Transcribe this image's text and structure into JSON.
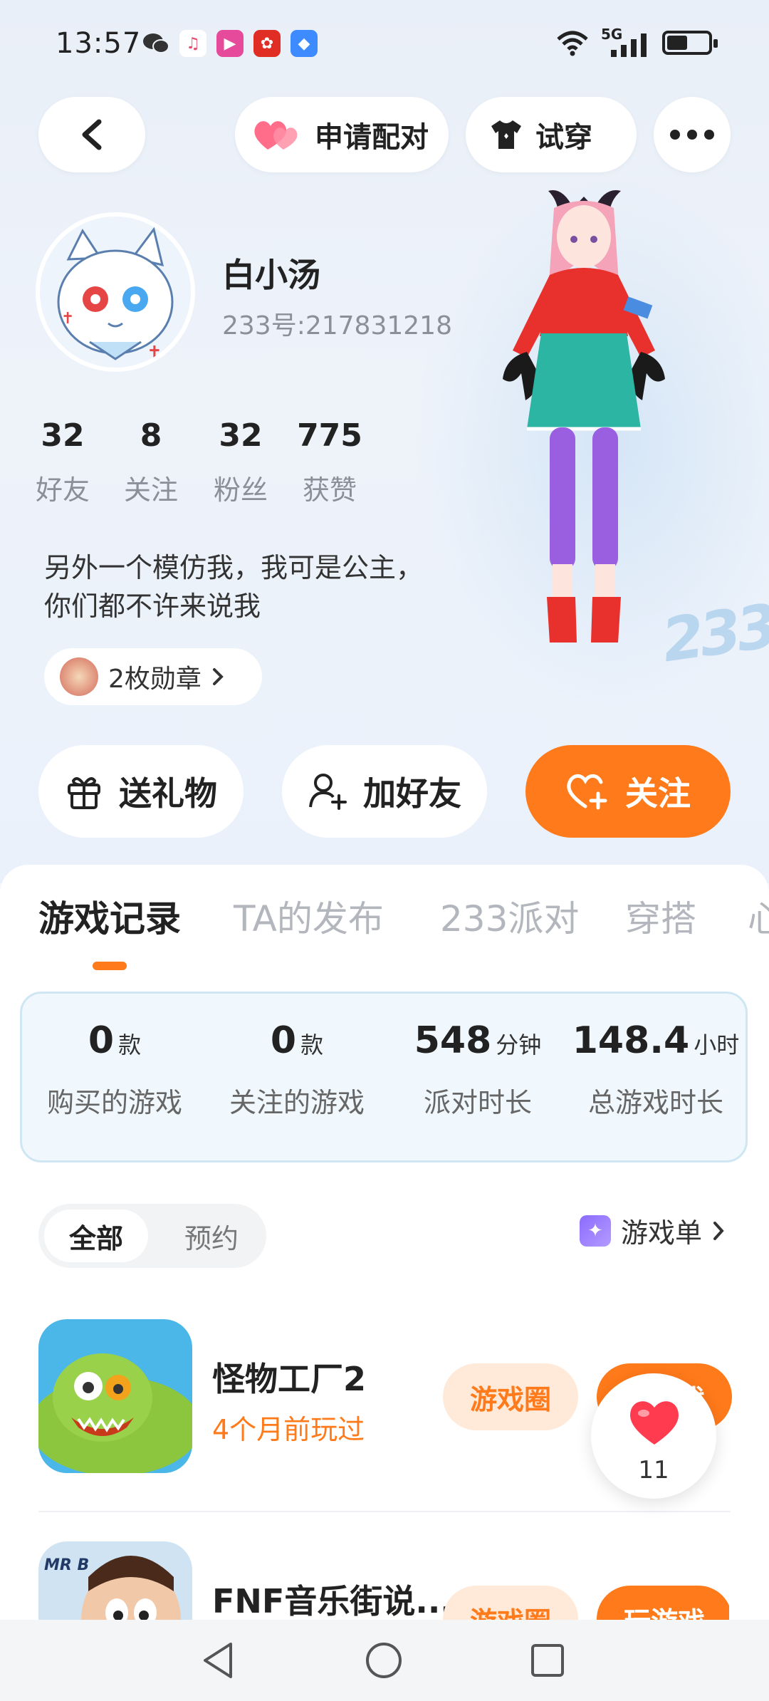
{
  "status_bar": {
    "time": "13:57",
    "network": "5G",
    "icons": [
      "wechat-icon",
      "music-icon",
      "video-icon",
      "pinduoduo-icon",
      "appstore-icon",
      "wifi-icon",
      "signal-icon",
      "battery-icon"
    ]
  },
  "header": {
    "back_icon": "chevron-left-icon",
    "pair_label": "申请配对",
    "tryon_label": "试穿",
    "more_icon": "more-icon"
  },
  "profile": {
    "name": "白小汤",
    "uid": "233号:217831218",
    "stats": [
      {
        "value": "32",
        "label": "好友"
      },
      {
        "value": "8",
        "label": "关注"
      },
      {
        "value": "32",
        "label": "粉丝"
      },
      {
        "value": "775",
        "label": "获赞"
      }
    ],
    "bio_line1": "另外一个模仿我，我可是公主，",
    "bio_line2": "你们都不许来说我",
    "medals_label": "2枚勋章"
  },
  "actions": {
    "gift_label": "送礼物",
    "add_friend_label": "加好友",
    "follow_label": "关注"
  },
  "tabs": [
    "游戏记录",
    "TA的发布",
    "233派对",
    "穿搭",
    "心"
  ],
  "game_stats": [
    {
      "value": "0",
      "unit": "款",
      "label": "购买的游戏"
    },
    {
      "value": "0",
      "unit": "款",
      "label": "关注的游戏"
    },
    {
      "value": "548",
      "unit": "分钟",
      "label": "派对时长"
    },
    {
      "value": "148.4",
      "unit": "小时",
      "label": "总游戏时长"
    }
  ],
  "filter": {
    "all_label": "全部",
    "reserve_label": "预约",
    "gamelist_label": "游戏单"
  },
  "games": [
    {
      "title": "怪物工厂2",
      "subtitle": "4个月前玩过",
      "circle_label": "游戏圈",
      "play_label": "玩游戏"
    },
    {
      "title": "FNF音乐街说...",
      "subtitle": "",
      "circle_label": "游戏圈",
      "play_label": "玩游戏"
    }
  ],
  "like_fab": {
    "count": "11"
  },
  "colors": {
    "accent": "#ff7a1a",
    "accent_soft": "#ffe9d8",
    "card_border": "#cfe6f3"
  }
}
